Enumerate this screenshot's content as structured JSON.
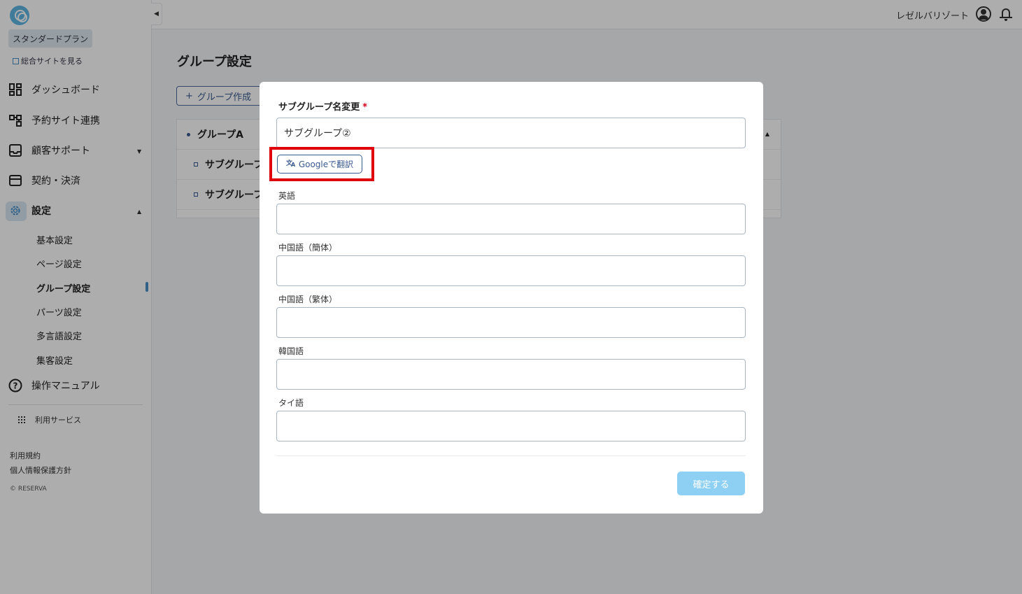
{
  "sidebar": {
    "plan": "スタンダードプラン",
    "site_link": "総合サイトを見る",
    "nav": {
      "dashboard": "ダッシュボード",
      "booking_sites": "予約サイト連携",
      "customer_support": "顧客サポート",
      "contract": "契約・決済",
      "settings": "設定",
      "manual": "操作マニュアル"
    },
    "settings_sub": [
      "基本設定",
      "ページ設定",
      "グループ設定",
      "パーツ設定",
      "多言語設定",
      "集客設定"
    ],
    "services": "利用サービス",
    "terms": "利用規約",
    "privacy": "個人情報保護方針",
    "copyright": "© RESERVA"
  },
  "header": {
    "user": "レゼルバリゾート"
  },
  "main": {
    "title": "グループ設定",
    "create_button": "グループ作成",
    "groups": [
      "グループA",
      "サブグルーフ",
      "サブグルーフ"
    ]
  },
  "modal": {
    "title": "サブグループ名変更",
    "required_mark": "*",
    "name_value": "サブグループ②",
    "translate_button": "Googleで翻訳",
    "fields": [
      "英語",
      "中国語（簡体）",
      "中国語（繁体）",
      "韓国語",
      "タイ語"
    ],
    "confirm_button": "確定する"
  },
  "colors": {
    "accent": "#4a90c8",
    "highlight": "#e0000b",
    "confirm_disabled": "#8ed0f3"
  }
}
